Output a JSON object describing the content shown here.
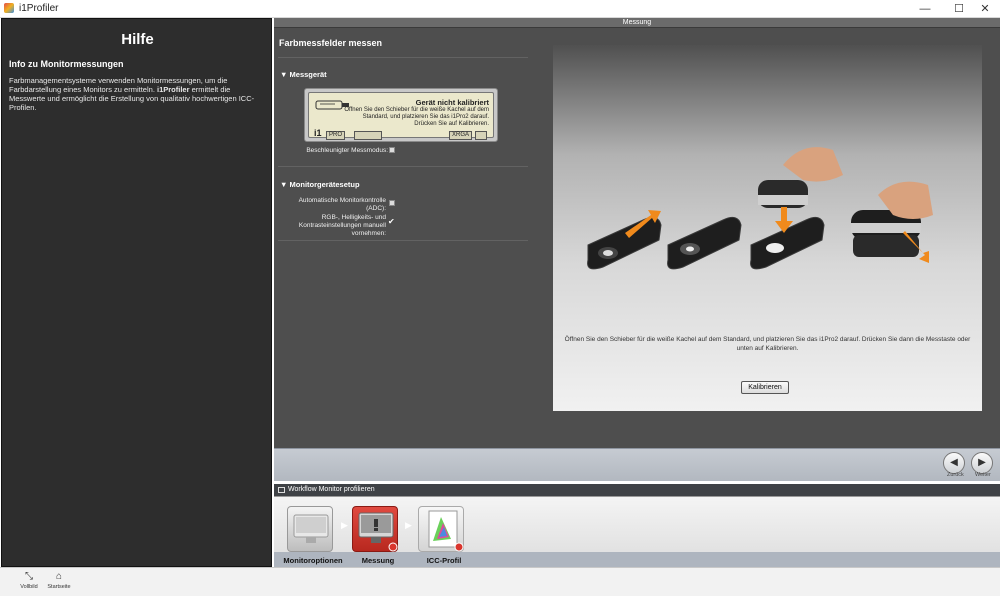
{
  "window": {
    "title": "i1Profiler",
    "minimize": "—",
    "maximize": "☐",
    "close": "✕"
  },
  "help": {
    "title": "Hilfe",
    "subtitle": "Info zu Monitormessungen",
    "text_part1": "Farbmanagementsysteme verwenden Monitormessungen, um die Farbdarstellung eines Monitors zu ermitteln. ",
    "text_bold": "i1Profiler",
    "text_part2": " ermittelt die Messwerte und ermöglicht die Erstellung von qualitativ hochwertigen ICC-Profilen."
  },
  "tab_header": "Messung",
  "main": {
    "title": "Farbmessfelder messen",
    "measuring_device": {
      "header": "Messgerät",
      "lcd_heading": "Gerät nicht kalibriert",
      "lcd_message": "Öffnen Sie den Schieber für die weiße Kachel auf dem Standard, und platzieren Sie das i1Pro2 darauf. Drücken Sie auf Kalibrieren.",
      "lcd_labels": [
        "PRO",
        "XRGA"
      ],
      "logo": "i1",
      "fast_mode_label": "Beschleunigter Messmodus:"
    },
    "monitor_setup": {
      "header": "Monitorgerätesetup",
      "adc_label": "Automatische Monitorkontrolle (ADC):",
      "manual_label": "RGB-, Helligkeits- und Kontrasteinstellungen manuell vornehmen:"
    }
  },
  "photo": {
    "caption": "Öffnen Sie den Schieber für die weiße Kachel auf dem Standard, und platzieren Sie das i1Pro2 darauf. Drücken Sie dann die Messtaste oder unten auf Kalibrieren.",
    "calibrate_button": "Kalibrieren"
  },
  "nav": {
    "back_label": "Zurück",
    "next_label": "Weiter"
  },
  "workflow": {
    "title": "Workflow Monitor profilieren",
    "steps": [
      {
        "label": "Monitoroptionen"
      },
      {
        "label": "Messung"
      },
      {
        "label": "ICC-Profil"
      }
    ]
  },
  "bottombar": {
    "fullscreen_label": "Vollbild",
    "home_label": "Startseite"
  },
  "colors": {
    "active_step": "#d9362e",
    "help_bg": "#2d2d2d",
    "center_bg": "#4e4e4e",
    "orange_arrow": "#f08a1c"
  }
}
